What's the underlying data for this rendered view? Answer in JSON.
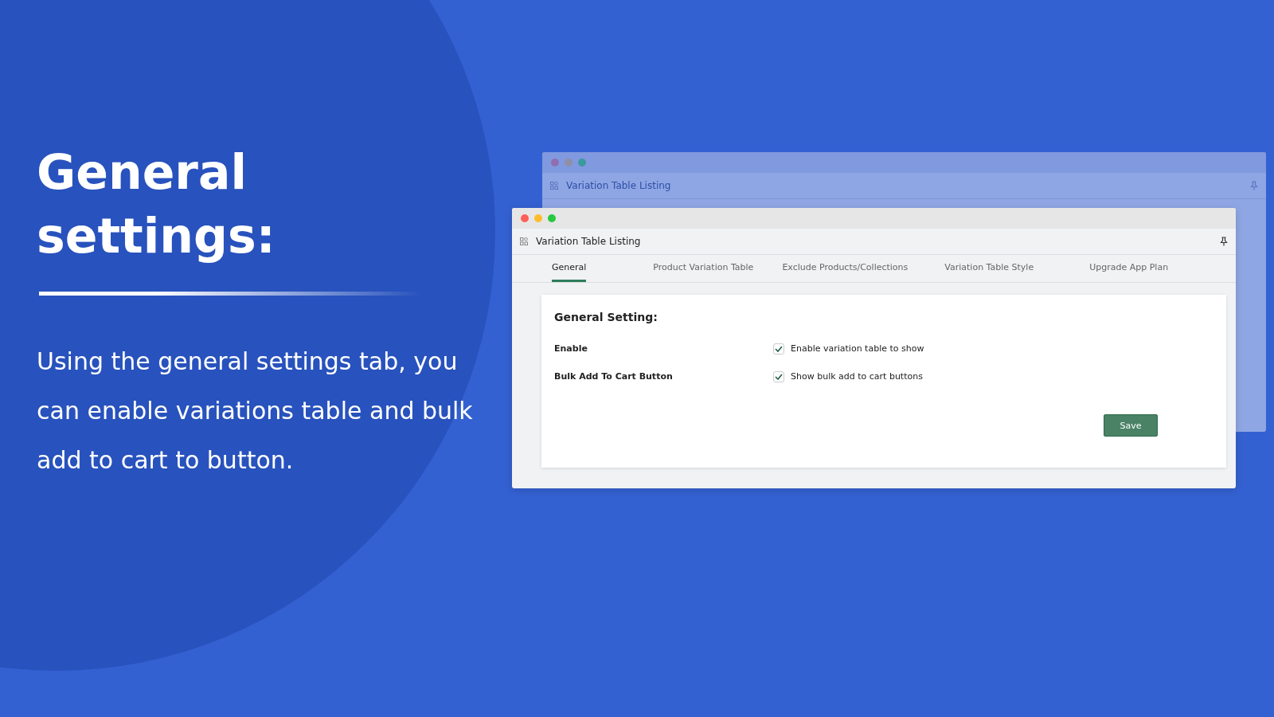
{
  "slide": {
    "heading": "General settings:",
    "description": "Using the general settings tab, you can enable variations table and bulk add to cart to button."
  },
  "back_window": {
    "title": "Variation Table Listing"
  },
  "window": {
    "title": "Variation Table Listing",
    "tabs": [
      {
        "label": "General",
        "selected": true
      },
      {
        "label": "Product Variation Table",
        "selected": false
      },
      {
        "label": "Exclude Products/Collections",
        "selected": false
      },
      {
        "label": "Variation Table Style",
        "selected": false
      },
      {
        "label": "Upgrade App Plan",
        "selected": false
      }
    ],
    "section_title": "General Setting:",
    "settings": [
      {
        "label": "Enable",
        "option": "Enable variation table to show",
        "checked": true
      },
      {
        "label": "Bulk Add To Cart Button",
        "option": "Show bulk add to cart buttons",
        "checked": true
      }
    ],
    "save_button": "Save"
  }
}
